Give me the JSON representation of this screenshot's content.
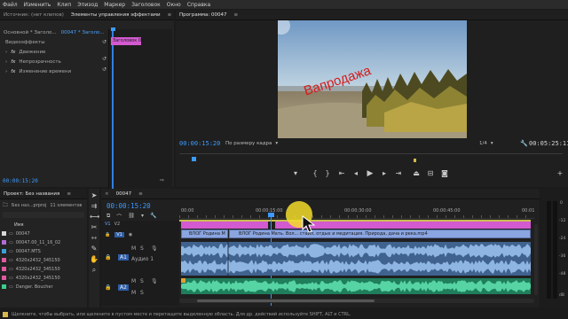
{
  "menu": [
    "Файл",
    "Изменить",
    "Клип",
    "Эпизод",
    "Маркер",
    "Заголовок",
    "Окно",
    "Справка"
  ],
  "effects_panel": {
    "tabs": [
      "Источник: (нет клипов)",
      "Элементы управления эффектами",
      "≡"
    ],
    "breadcrumb_master": "Основной * Заголо...",
    "breadcrumb_clip": "00047 * Заголо...",
    "section_label": "Видеоэффекты",
    "effects": [
      "Движение",
      "Непрозрачность",
      "Изменение времени"
    ],
    "clip_chip": "Заголовок 05",
    "timecode": "00:00:15:20"
  },
  "program": {
    "tab_title": "Программа: 00047",
    "overlay_text": "Вапродажа",
    "timecode": "00:00:15:20",
    "fit_label": "По размеру кадра",
    "resolution": "1/4",
    "duration": "00:05:25:11"
  },
  "project": {
    "tab_title": "Проект: Без названия",
    "file_name": "Без наз...prproj",
    "item_count": "11 элементов",
    "column_name": "Имя",
    "items": [
      {
        "label": "00047",
        "color": "#d6d6d6"
      },
      {
        "label": "00047.00_11_16_02",
        "color": "#b46ad6"
      },
      {
        "label": "00047.MTS",
        "color": "#3aa0d8"
      },
      {
        "label": "4320x2432_345150",
        "color": "#e05aa0"
      },
      {
        "label": "4320x2432_345150",
        "color": "#e05aa0"
      },
      {
        "label": "4320x2432_345150",
        "color": "#e05aa0"
      },
      {
        "label": "Danger. Boucher",
        "color": "#3ad08a"
      }
    ]
  },
  "timeline": {
    "tab_title": "00047",
    "timecode": "00:00:15:20",
    "ruler": [
      "00:00",
      "00:00:15:00",
      "00:00:30:00",
      "00:00:45:00",
      "00:01"
    ],
    "tracks_video": [
      "V2",
      "V1"
    ],
    "tracks_audio": [
      "A1",
      "A2"
    ],
    "audio1_name": "Аудио 1",
    "v2_clips": [
      "ВЛОГ Родина М",
      "ВЛОГ Родина Мать. Вол... стайл, отдых и медитация. Природа, дача и река.mp4"
    ],
    "track_btns": [
      "M",
      "S"
    ]
  },
  "meter_labels": [
    "0",
    "-12",
    "-24",
    "-36",
    "-48",
    "dB"
  ],
  "status_text": "Щелкните, чтобы выбрать, или щелкните в пустом месте и перетащите выделенную область. Для др. действий используйте SHIFT, ALT и CTRL.",
  "colors": {
    "accent": "#3d9bff",
    "title_chip": "#d35ad0",
    "clip_blue": "#6f8fd0",
    "audio_blue": "#5b85b5",
    "audio_green": "#2fa57a",
    "highlight": "#f3dd2a"
  }
}
